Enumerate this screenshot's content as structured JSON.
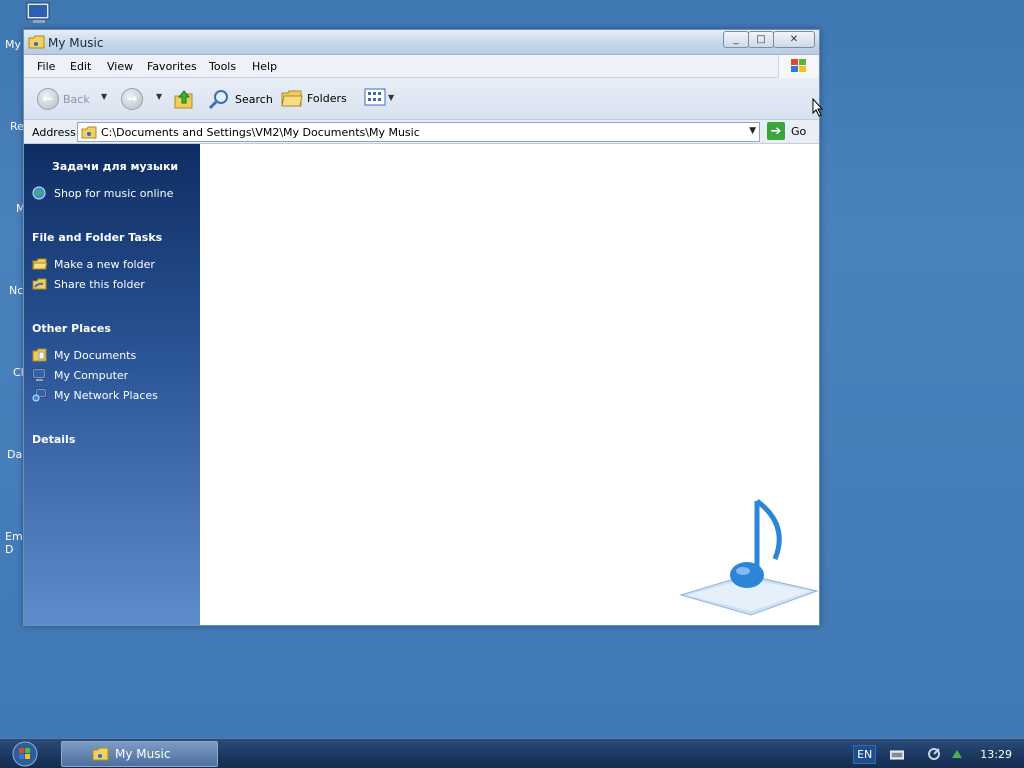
{
  "desktop": {
    "icon_labels": [
      "My",
      "Re",
      "M",
      "Nc",
      "Cl",
      "Da",
      "Em\nD"
    ]
  },
  "window": {
    "title": "My Music",
    "buttons": {
      "minimize": "_",
      "maximize": "□",
      "close": "✕"
    }
  },
  "menu": {
    "items": [
      "File",
      "Edit",
      "View",
      "Favorites",
      "Tools",
      "Help"
    ]
  },
  "toolbar": {
    "back_label": "Back",
    "search_label": "Search",
    "folders_label": "Folders"
  },
  "address": {
    "label": "Address",
    "path": "C:\\Documents and Settings\\VM2\\My Documents\\My Music",
    "go_label": "Go"
  },
  "taskpane": {
    "music_tasks_header": "Задачи для музыки",
    "music_tasks": [
      "Shop for music online"
    ],
    "file_tasks_header": "File and Folder Tasks",
    "file_tasks": [
      "Make a new folder",
      "Share this folder"
    ],
    "other_places_header": "Other Places",
    "other_places": [
      "My Documents",
      "My Computer",
      "My Network Places"
    ],
    "details_header": "Details"
  },
  "taskbar": {
    "task_label": "My Music",
    "language": "EN",
    "clock": "13:29"
  },
  "colors": {
    "desktop": "#3f77b2",
    "taskpane_top": "#0f2d63",
    "taskpane_bottom": "#5f8ccc",
    "taskbar": "#1d3a64"
  }
}
